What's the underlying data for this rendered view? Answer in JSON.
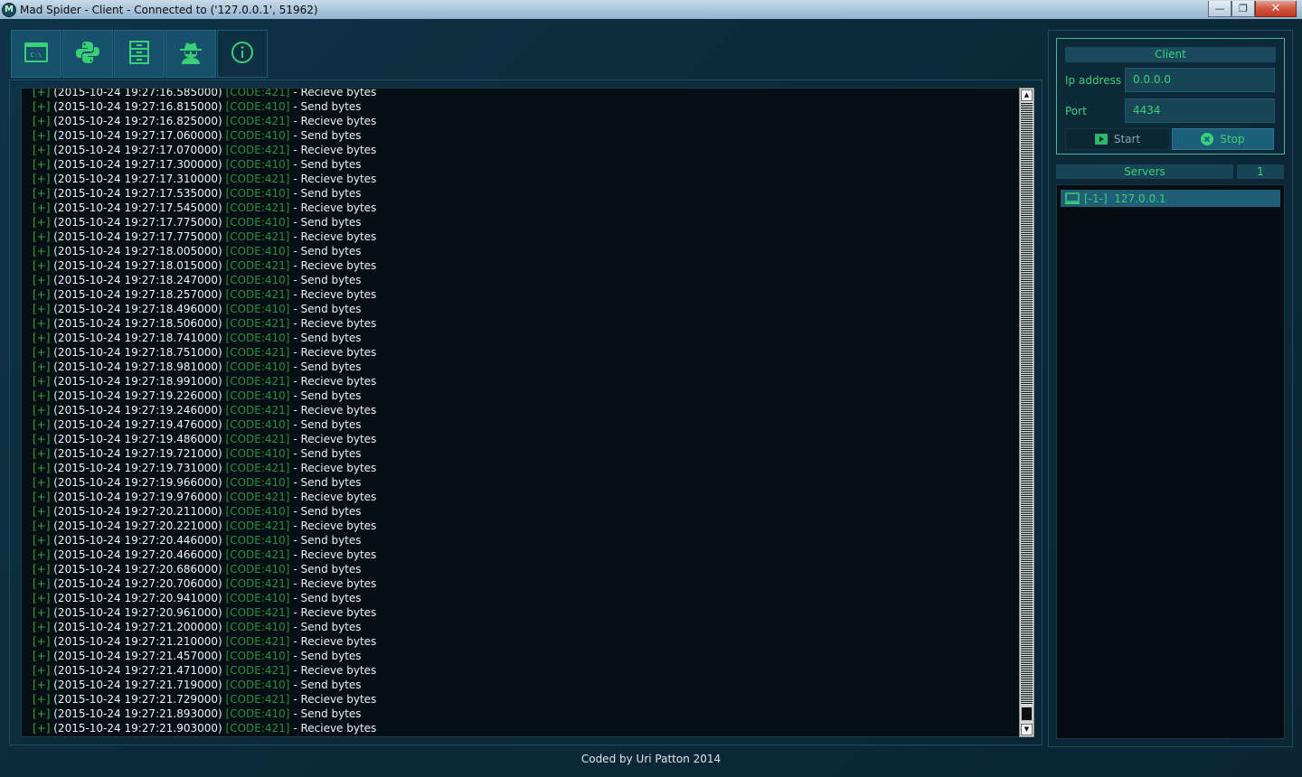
{
  "window": {
    "title": "Mad Spider - Client - Connected to ('127.0.0.1', 51962)",
    "app_icon_letter": "M",
    "minimize": "—",
    "maximize": "❐",
    "close": "✕"
  },
  "toolbar": {
    "items": [
      {
        "icon": "terminal-icon",
        "label": "C:\\"
      },
      {
        "icon": "python-icon"
      },
      {
        "icon": "file-cabinet-icon"
      },
      {
        "icon": "spy-icon"
      },
      {
        "icon": "info-icon"
      }
    ]
  },
  "log": {
    "tag": "[+]",
    "code_send": "[CODE:410]",
    "code_recv": "[CODE:421]",
    "send_text": "- Send bytes",
    "recv_text": "- Recieve bytes",
    "entries": [
      {
        "ts": "(2015-10-24 19:27:16.585000)",
        "type": "recv"
      },
      {
        "ts": "(2015-10-24 19:27:16.815000)",
        "type": "send"
      },
      {
        "ts": "(2015-10-24 19:27:16.825000)",
        "type": "recv"
      },
      {
        "ts": "(2015-10-24 19:27:17.060000)",
        "type": "send"
      },
      {
        "ts": "(2015-10-24 19:27:17.070000)",
        "type": "recv"
      },
      {
        "ts": "(2015-10-24 19:27:17.300000)",
        "type": "send"
      },
      {
        "ts": "(2015-10-24 19:27:17.310000)",
        "type": "recv"
      },
      {
        "ts": "(2015-10-24 19:27:17.535000)",
        "type": "send"
      },
      {
        "ts": "(2015-10-24 19:27:17.545000)",
        "type": "recv"
      },
      {
        "ts": "(2015-10-24 19:27:17.775000)",
        "type": "send"
      },
      {
        "ts": "(2015-10-24 19:27:17.775000)",
        "type": "recv"
      },
      {
        "ts": "(2015-10-24 19:27:18.005000)",
        "type": "send"
      },
      {
        "ts": "(2015-10-24 19:27:18.015000)",
        "type": "recv"
      },
      {
        "ts": "(2015-10-24 19:27:18.247000)",
        "type": "send"
      },
      {
        "ts": "(2015-10-24 19:27:18.257000)",
        "type": "recv"
      },
      {
        "ts": "(2015-10-24 19:27:18.496000)",
        "type": "send"
      },
      {
        "ts": "(2015-10-24 19:27:18.506000)",
        "type": "recv"
      },
      {
        "ts": "(2015-10-24 19:27:18.741000)",
        "type": "send"
      },
      {
        "ts": "(2015-10-24 19:27:18.751000)",
        "type": "recv"
      },
      {
        "ts": "(2015-10-24 19:27:18.981000)",
        "type": "send"
      },
      {
        "ts": "(2015-10-24 19:27:18.991000)",
        "type": "recv"
      },
      {
        "ts": "(2015-10-24 19:27:19.226000)",
        "type": "send"
      },
      {
        "ts": "(2015-10-24 19:27:19.246000)",
        "type": "recv"
      },
      {
        "ts": "(2015-10-24 19:27:19.476000)",
        "type": "send"
      },
      {
        "ts": "(2015-10-24 19:27:19.486000)",
        "type": "recv"
      },
      {
        "ts": "(2015-10-24 19:27:19.721000)",
        "type": "send"
      },
      {
        "ts": "(2015-10-24 19:27:19.731000)",
        "type": "recv"
      },
      {
        "ts": "(2015-10-24 19:27:19.966000)",
        "type": "send"
      },
      {
        "ts": "(2015-10-24 19:27:19.976000)",
        "type": "recv"
      },
      {
        "ts": "(2015-10-24 19:27:20.211000)",
        "type": "send"
      },
      {
        "ts": "(2015-10-24 19:27:20.221000)",
        "type": "recv"
      },
      {
        "ts": "(2015-10-24 19:27:20.446000)",
        "type": "send"
      },
      {
        "ts": "(2015-10-24 19:27:20.466000)",
        "type": "recv"
      },
      {
        "ts": "(2015-10-24 19:27:20.686000)",
        "type": "send"
      },
      {
        "ts": "(2015-10-24 19:27:20.706000)",
        "type": "recv"
      },
      {
        "ts": "(2015-10-24 19:27:20.941000)",
        "type": "send"
      },
      {
        "ts": "(2015-10-24 19:27:20.961000)",
        "type": "recv"
      },
      {
        "ts": "(2015-10-24 19:27:21.200000)",
        "type": "send"
      },
      {
        "ts": "(2015-10-24 19:27:21.210000)",
        "type": "recv"
      },
      {
        "ts": "(2015-10-24 19:27:21.457000)",
        "type": "send"
      },
      {
        "ts": "(2015-10-24 19:27:21.471000)",
        "type": "recv"
      },
      {
        "ts": "(2015-10-24 19:27:21.719000)",
        "type": "send"
      },
      {
        "ts": "(2015-10-24 19:27:21.729000)",
        "type": "recv"
      },
      {
        "ts": "(2015-10-24 19:27:21.893000)",
        "type": "send"
      },
      {
        "ts": "(2015-10-24 19:27:21.903000)",
        "type": "recv"
      }
    ]
  },
  "client": {
    "title": "Client",
    "ip_label": "Ip address",
    "ip_value": "0.0.0.0",
    "port_label": "Port",
    "port_value": "4434",
    "start_label": "Start",
    "stop_label": "Stop"
  },
  "servers": {
    "label": "Servers",
    "count": "1",
    "items": [
      {
        "label": "[-1-]  127.0.0.1"
      }
    ]
  },
  "footer": {
    "text": "Coded by Uri Patton 2014"
  },
  "colors": {
    "accent_green": "#3ad078",
    "log_tag_green": "#34a34a",
    "panel_blue": "#174556",
    "background": "#0c2a3b"
  }
}
